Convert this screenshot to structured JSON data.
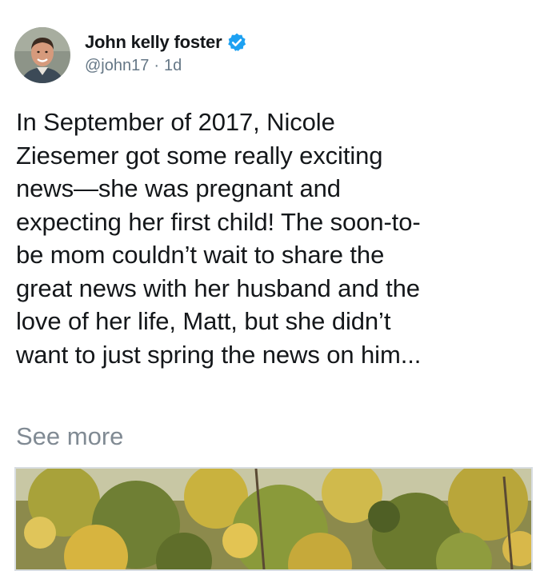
{
  "tweet": {
    "author": {
      "name": "John kelly foster",
      "handle": "@john17",
      "separator": "·",
      "age": "1d",
      "verified": true,
      "avatar_icon": "user-avatar"
    },
    "text_lines": [
      "In September of 2017, Nicole",
      "Ziesemer got some really exciting",
      "news—she was pregnant and",
      "expecting her first child! The soon-to-",
      "be mom couldn’t wait to share the",
      "great news with her husband and the",
      "love of her life, Matt, but she didn’t",
      "want to just spring the news on him..."
    ],
    "see_more_label": "See more",
    "media": {
      "icon": "photo-autumn-foliage"
    }
  },
  "colors": {
    "verified_blue": "#1da1f2",
    "handle_gray": "#657786",
    "see_more_gray": "#808a93",
    "text": "#14171a"
  }
}
